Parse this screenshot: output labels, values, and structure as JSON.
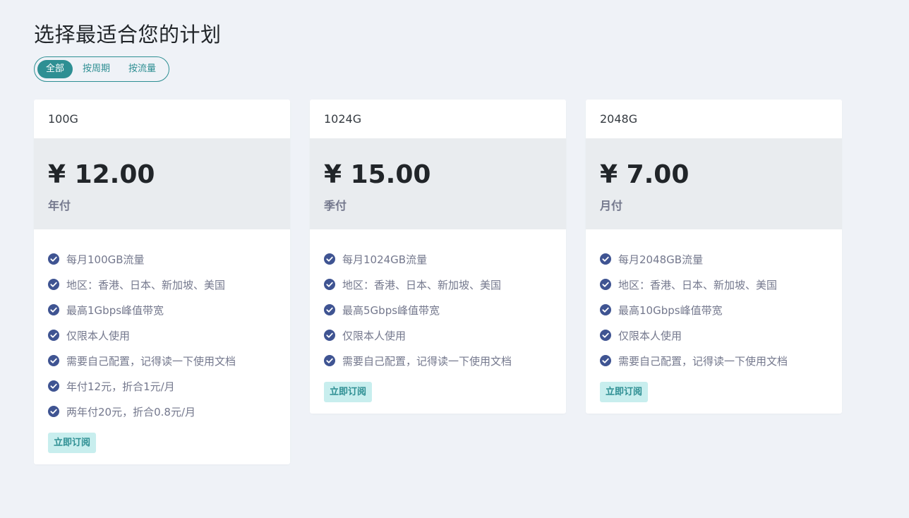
{
  "page": {
    "title": "选择最适合您的计划"
  },
  "filters": [
    {
      "label": "全部",
      "active": true
    },
    {
      "label": "按周期",
      "active": false
    },
    {
      "label": "按流量",
      "active": false
    }
  ],
  "plans": [
    {
      "name": "100G",
      "price": "¥ 12.00",
      "period": "年付",
      "features": [
        "每月100GB流量",
        "地区：香港、日本、新加坡、美国",
        "最高1Gbps峰值带宽",
        "仅限本人使用",
        "需要自己配置，记得读一下使用文档",
        "年付12元，折合1元/月",
        "两年付20元，折合0.8元/月"
      ],
      "button": "立即订阅"
    },
    {
      "name": "1024G",
      "price": "¥ 15.00",
      "period": "季付",
      "features": [
        "每月1024GB流量",
        "地区：香港、日本、新加坡、美国",
        "最高5Gbps峰值带宽",
        "仅限本人使用",
        "需要自己配置，记得读一下使用文档"
      ],
      "button": "立即订阅"
    },
    {
      "name": "2048G",
      "price": "¥ 7.00",
      "period": "月付",
      "features": [
        "每月2048GB流量",
        "地区：香港、日本、新加坡、美国",
        "最高10Gbps峰值带宽",
        "仅限本人使用",
        "需要自己配置，记得读一下使用文档"
      ],
      "button": "立即订阅"
    }
  ],
  "icons": {
    "feature": "check-circle-icon"
  },
  "colors": {
    "accent": "#2e8f93",
    "check": "#3f5492",
    "price_bg": "#e9ecef",
    "page_bg": "#eff2f7",
    "button_bg": "#c8eeee"
  }
}
